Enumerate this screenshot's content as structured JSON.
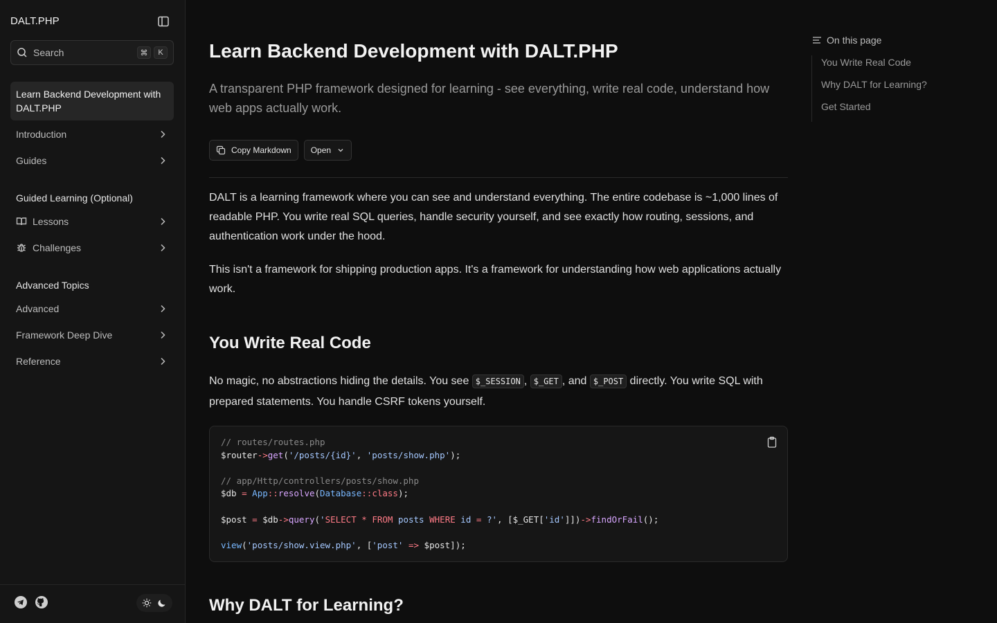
{
  "sidebar": {
    "brand": "DALT.PHP",
    "search": {
      "placeholder": "Search",
      "kbd1": "⌘",
      "kbd2": "K"
    },
    "active_item": "Learn Backend Development with DALT.PHP",
    "items_top": [
      {
        "label": "Introduction"
      },
      {
        "label": "Guides"
      }
    ],
    "group_learning": "Guided Learning (Optional)",
    "items_learning": [
      {
        "label": "Lessons",
        "icon": "book-icon"
      },
      {
        "label": "Challenges",
        "icon": "bug-icon"
      }
    ],
    "group_advanced": "Advanced Topics",
    "items_advanced": [
      {
        "label": "Advanced"
      },
      {
        "label": "Framework Deep Dive"
      },
      {
        "label": "Reference"
      }
    ]
  },
  "main": {
    "title": "Learn Backend Development with DALT.PHP",
    "subtitle": "A transparent PHP framework designed for learning - see everything, write real code, understand how web apps actually work.",
    "copy_markdown": "Copy Markdown",
    "open": "Open",
    "para1": "DALT is a learning framework where you can see and understand everything. The entire codebase is ~1,000 lines of readable PHP. You write real SQL queries, handle security yourself, and see exactly how routing, sessions, and authentication work under the hood.",
    "para2": "This isn't a framework for shipping production apps. It's a framework for understanding how web applications actually work.",
    "section1": "You Write Real Code",
    "para3_a": "No magic, no abstractions hiding the details. You see ",
    "code_session": "$_SESSION",
    "para3_b": ", ",
    "code_get": "$_GET",
    "para3_c": ", and ",
    "code_post": "$_POST",
    "para3_d": " directly. You write SQL with prepared statements. You handle CSRF tokens yourself.",
    "section2": "Why DALT for Learning?"
  },
  "toc": {
    "heading": "On this page",
    "items": [
      "You Write Real Code",
      "Why DALT for Learning?",
      "Get Started"
    ]
  },
  "colors": {
    "background": "#0e0e0e",
    "sidebar": "#151515",
    "accent_string": "#a5c8ff",
    "accent_function": "#d8a6ff",
    "accent_keyword": "#ff7b86"
  }
}
